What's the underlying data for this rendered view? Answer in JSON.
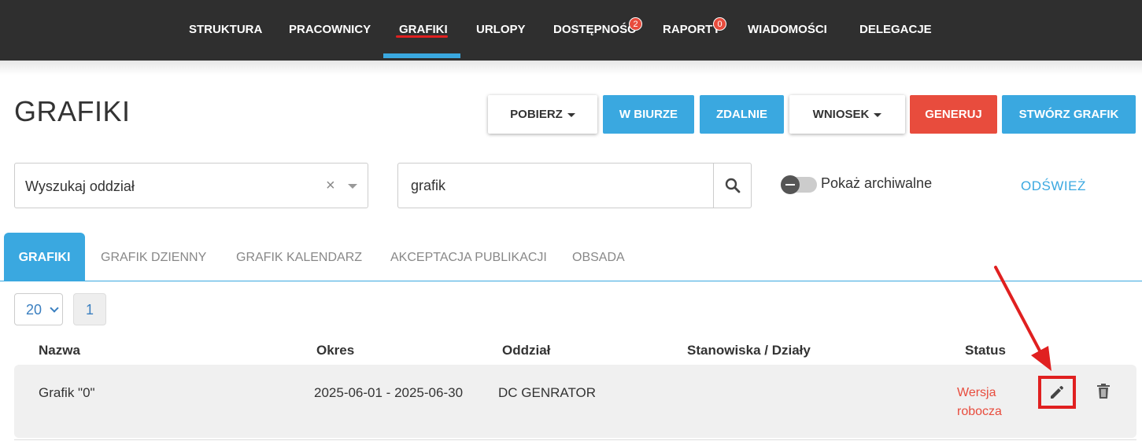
{
  "nav": {
    "items": [
      {
        "label": "STRUKTURA"
      },
      {
        "label": "PRACOWNICY"
      },
      {
        "label": "GRAFIKI"
      },
      {
        "label": "URLOPY"
      },
      {
        "label": "DOSTĘPNOŚĆ",
        "badge": "2"
      },
      {
        "label": "RAPORTY",
        "badge": "0"
      },
      {
        "label": "WIADOMOŚCI"
      },
      {
        "label": "DELEGACJE"
      }
    ],
    "active": "GRAFIKI"
  },
  "page": {
    "title": "GRAFIKI"
  },
  "toolbar": {
    "pobierz": "POBIERZ",
    "w_biurze": "W BIURZE",
    "zdalnie": "ZDALNIE",
    "wniosek": "WNIOSEK",
    "generuj": "GENERUJ",
    "stworz": "STWÓRZ GRAFIK"
  },
  "filters": {
    "department_select": "Wyszukaj oddział",
    "clear_symbol": "×",
    "search_value": "grafik",
    "archive_toggle_label": "Pokaż archiwalne",
    "refresh": "ODŚWIEŻ"
  },
  "tabs": [
    "GRAFIKI",
    "GRAFIK DZIENNY",
    "GRAFIK KALENDARZ",
    "AKCEPTACJA PUBLIKACJI",
    "OBSADA"
  ],
  "pagination": {
    "page_size": "20",
    "current_page": "1"
  },
  "table": {
    "headers": [
      "Nazwa",
      "Okres",
      "Oddział",
      "Stanowiska / Działy",
      "Status"
    ],
    "rows": [
      {
        "name": "Grafik \"0\"",
        "period": "2025-06-01 - 2025-06-30",
        "department": "DC GENRATOR",
        "positions": "",
        "status_line1": "Wersja",
        "status_line2": "robocza"
      }
    ]
  },
  "colors": {
    "accent": "#3aa8e0",
    "danger": "#e84c3d",
    "nav_bg": "#2f2f2f",
    "annotation": "#e02020"
  },
  "icons": [
    "search-icon",
    "edit-icon",
    "trash-icon",
    "caret-down-icon"
  ]
}
